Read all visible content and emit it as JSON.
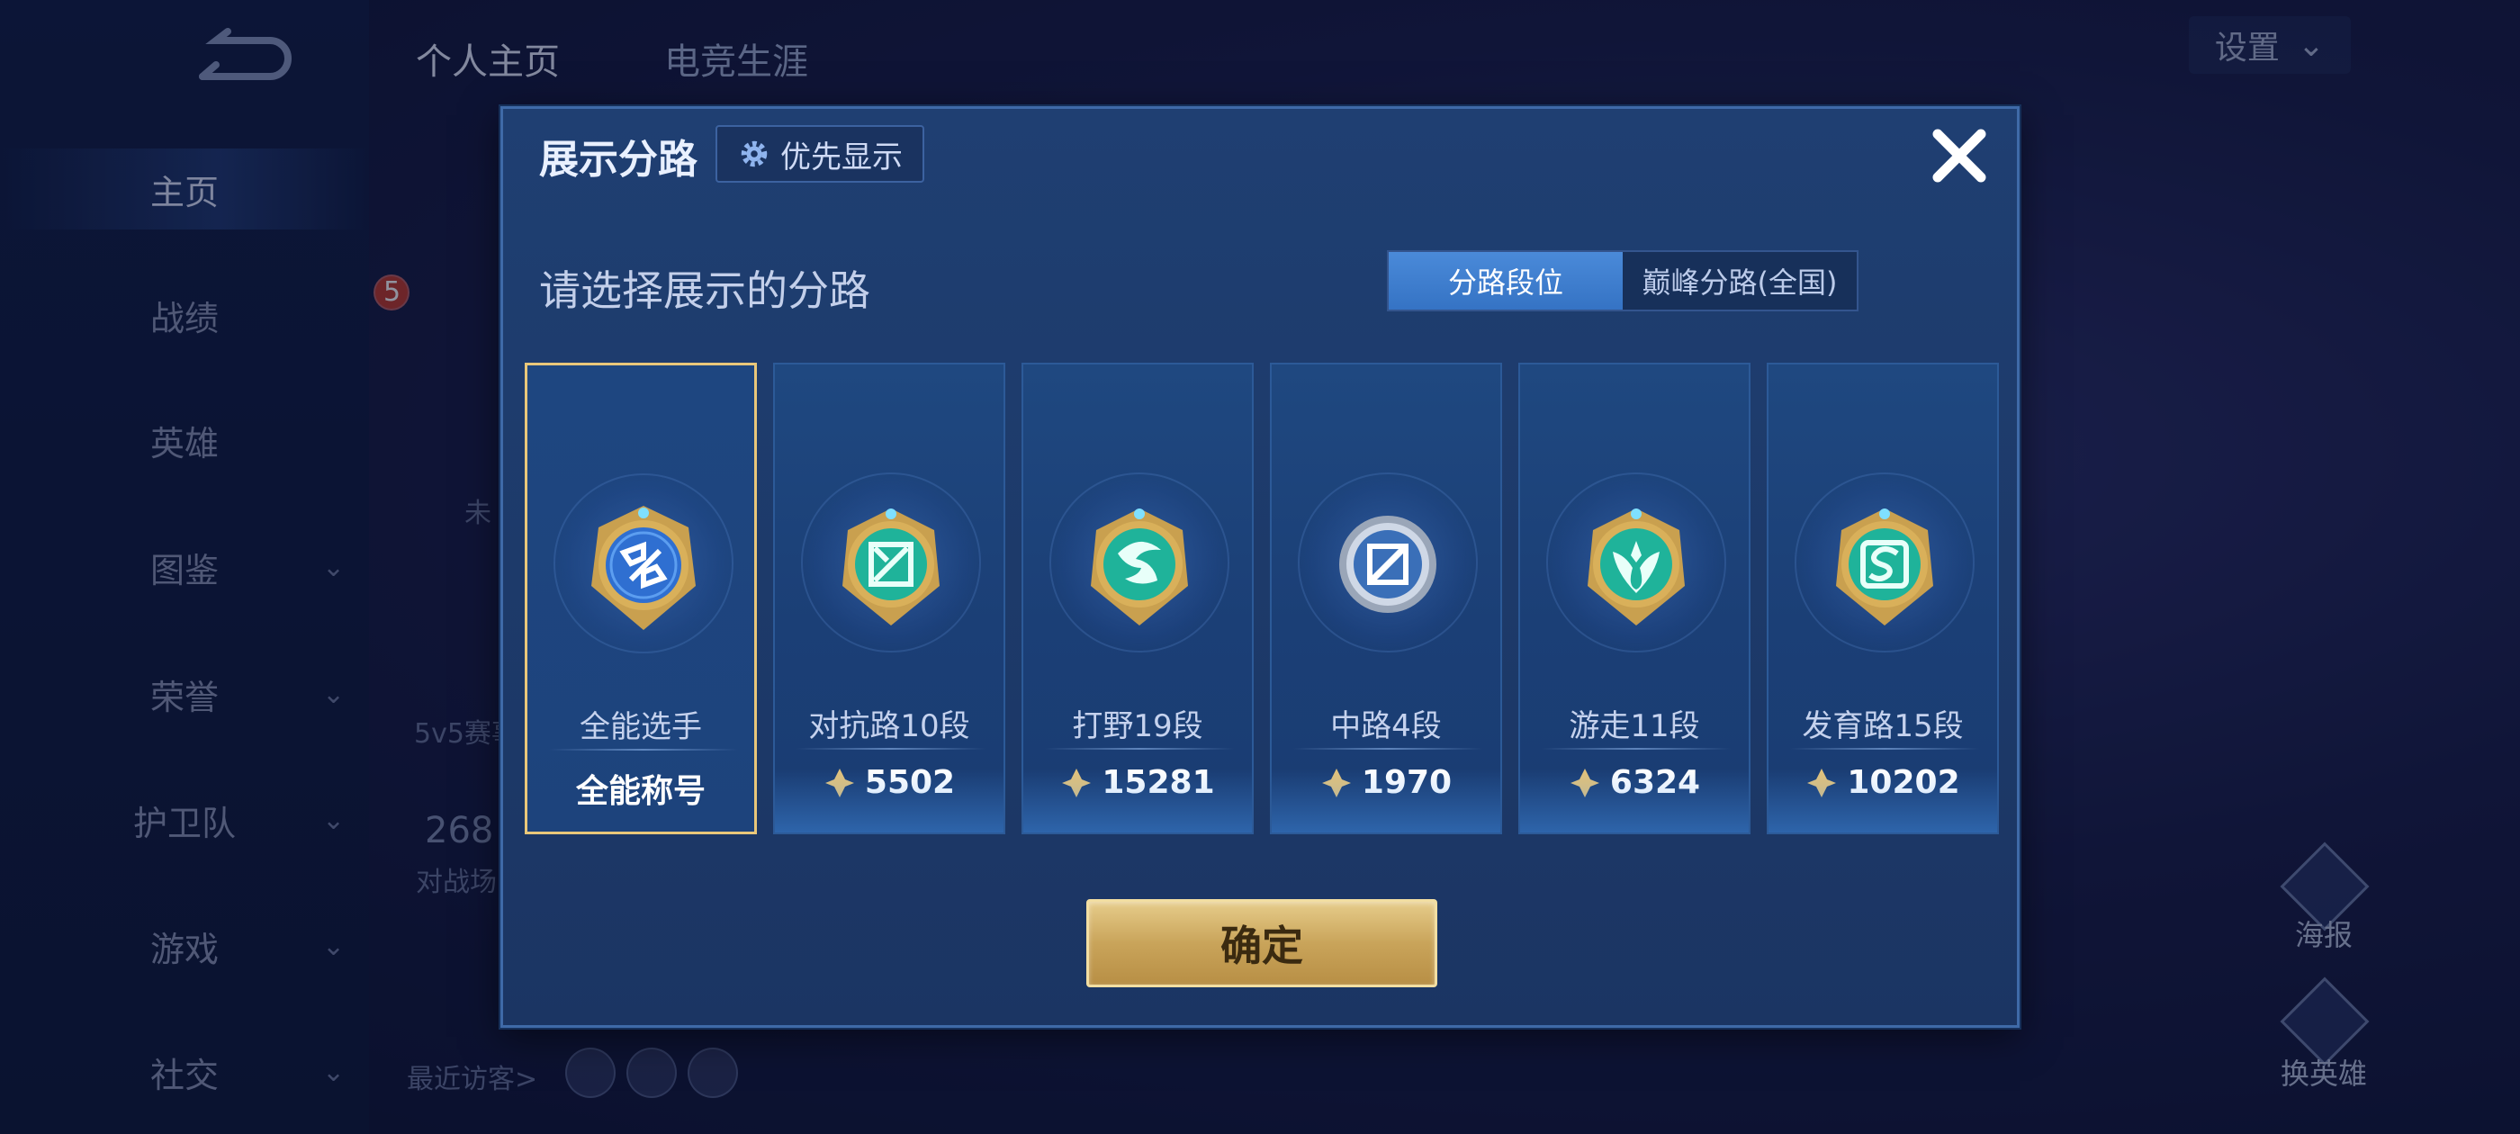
{
  "background": {
    "sidebar": {
      "items": [
        {
          "label": "主页",
          "active": true
        },
        {
          "label": "战绩"
        },
        {
          "label": "英雄"
        },
        {
          "label": "图鉴",
          "chevron": true
        },
        {
          "label": "荣誉",
          "chevron": true
        },
        {
          "label": "护卫队",
          "chevron": true
        },
        {
          "label": "游戏",
          "chevron": true
        },
        {
          "label": "社交",
          "chevron": true
        }
      ]
    },
    "tabs": [
      "个人主页",
      "电竞生涯"
    ],
    "settings_label": "设置",
    "recent_visitors": "最近访客>",
    "level_badge": "5",
    "mode_text": "5v5赛事",
    "stat_number": "268",
    "stat_label": "对战场",
    "status_text": "未",
    "right_actions": {
      "poster": "海报",
      "switch_hero": "换英雄"
    }
  },
  "modal": {
    "title": "展示分路",
    "priority_label": "优先显示",
    "subtitle": "请选择展示的分路",
    "segments": [
      {
        "label": "分路段位",
        "active": true
      },
      {
        "label": "巅峰分路(全国)",
        "active": false
      }
    ],
    "cards": [
      {
        "name": "全能选手",
        "value": "全能称号",
        "icon": "all-round-badge-icon",
        "selected": true
      },
      {
        "name": "对抗路10段",
        "value": "5502",
        "icon": "clash-lane-badge-icon"
      },
      {
        "name": "打野19段",
        "value": "15281",
        "icon": "jungle-badge-icon"
      },
      {
        "name": "中路4段",
        "value": "1970",
        "icon": "mid-lane-badge-icon"
      },
      {
        "name": "游走11段",
        "value": "6324",
        "icon": "roam-badge-icon"
      },
      {
        "name": "发育路15段",
        "value": "10202",
        "icon": "farm-lane-badge-icon"
      }
    ],
    "confirm_label": "确定"
  },
  "colors": {
    "accent_gold": "#e9c77a",
    "panel": "#1f3f72",
    "segment_active": "#4a8ad9"
  }
}
